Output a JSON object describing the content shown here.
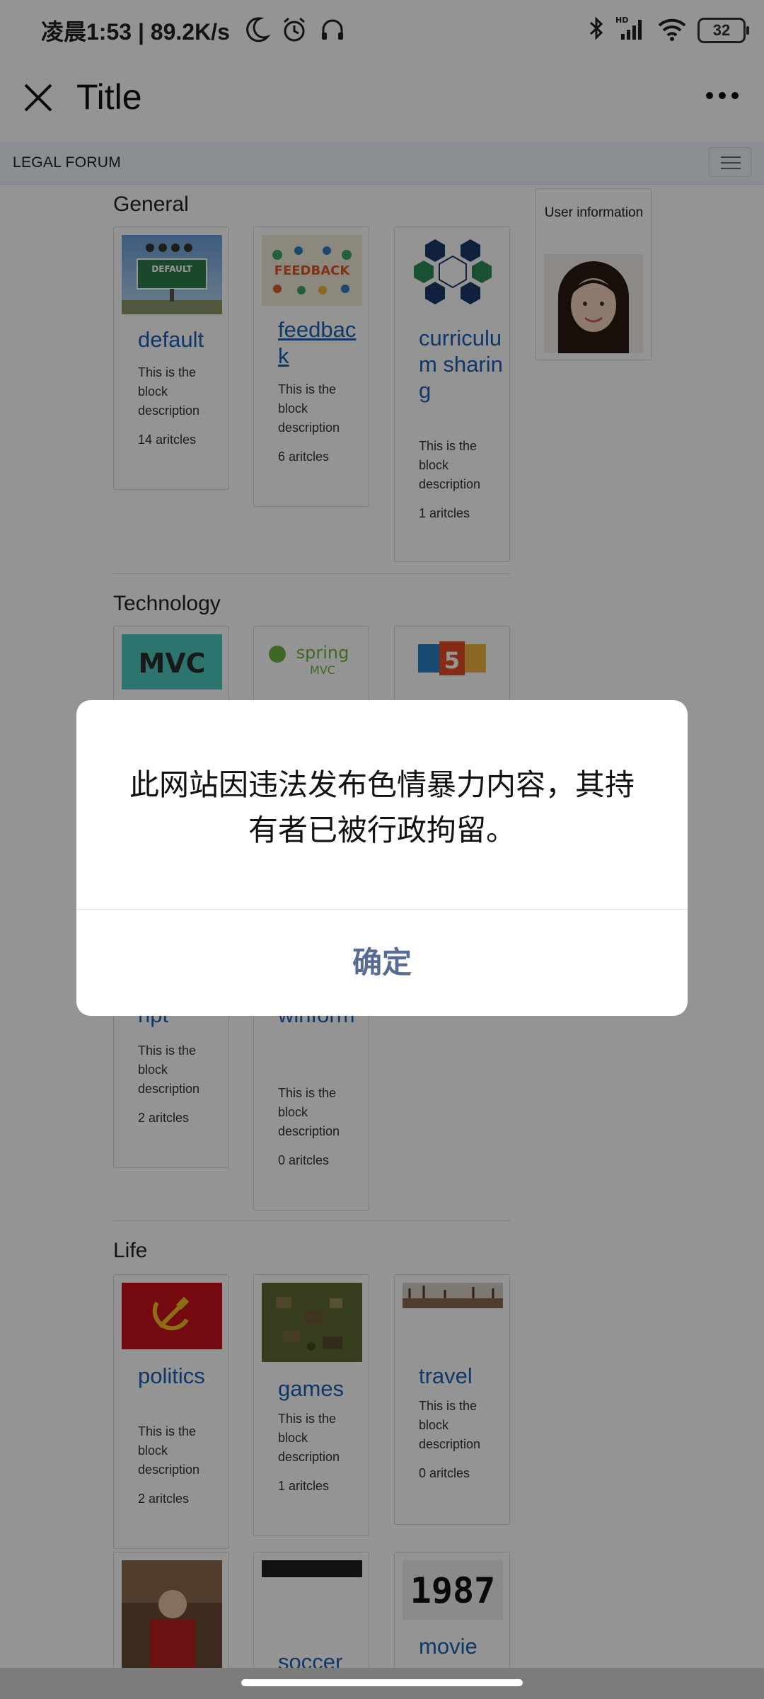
{
  "status_bar": {
    "time": "凌晨1:53 | 89.2K/s",
    "battery": "32",
    "icons": [
      "moon-icon",
      "alarm-icon",
      "headset-icon",
      "bluetooth-icon",
      "signal-hd-icon",
      "wifi-icon",
      "battery-icon"
    ]
  },
  "titlebar": {
    "title": "Title"
  },
  "navbar": {
    "brand": "LEGAL FORUM"
  },
  "sidebar": {
    "user_label": "User information"
  },
  "sections": [
    {
      "title": "General",
      "blocks": [
        {
          "name": "default",
          "desc": "This is the block description",
          "count": "14 aritcles"
        },
        {
          "name": "feedback",
          "desc": "This is the block description",
          "count": "6 aritcles"
        },
        {
          "name": "curriculum sharing",
          "desc": "This is the block description",
          "count": "1 aritcles"
        }
      ]
    },
    {
      "title": "Technology",
      "blocks": [
        {
          "name": "ript",
          "desc": "This is the block description",
          "count": "2 aritcles"
        },
        {
          "name": "winform",
          "desc": "This is the block description",
          "count": "0 aritcles"
        }
      ]
    },
    {
      "title": "Life",
      "blocks": [
        {
          "name": "politics",
          "desc": "This is the block description",
          "count": "2 aritcles"
        },
        {
          "name": "games",
          "desc": "This is the block description",
          "count": "1 aritcles"
        },
        {
          "name": "travel",
          "desc": "This is the block description",
          "count": "0 aritcles"
        },
        {
          "name": "soccer"
        },
        {
          "name": "movie"
        }
      ]
    }
  ],
  "thumb_text": {
    "default": "DEFAULT",
    "feedback": "FEEDBACK",
    "mvc": "MVC",
    "spring": "spring",
    "spring_sub": "MVC",
    "year": "1987"
  },
  "dialog": {
    "message": "此网站因违法发布色情暴力内容，其持有者已被行政拘留。",
    "confirm": "确定"
  },
  "colors": {
    "link": "#1a5fb4",
    "dialog_button": "#576b95",
    "overlay": "rgba(0,0,0,0.42)"
  }
}
